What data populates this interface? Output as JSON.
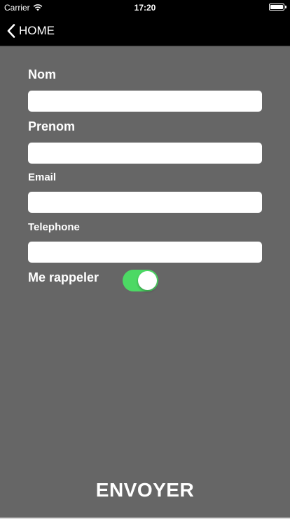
{
  "status_bar": {
    "carrier": "Carrier",
    "time": "17:20",
    "wifi_icon": "wifi-icon",
    "battery_icon": "battery-icon"
  },
  "nav": {
    "back_label": "HOME",
    "back_icon": "chevron-left-icon"
  },
  "form": {
    "nom_label": "Nom",
    "nom_value": "",
    "prenom_label": "Prenom",
    "prenom_value": "",
    "email_label": "Email",
    "email_value": "",
    "telephone_label": "Telephone",
    "telephone_value": "",
    "callback_label": "Me rappeler",
    "callback_on": true
  },
  "actions": {
    "send_label": "ENVOYER"
  },
  "colors": {
    "background": "#666666",
    "bar": "#000000",
    "toggle_on": "#4cd964",
    "text": "#ffffff"
  }
}
